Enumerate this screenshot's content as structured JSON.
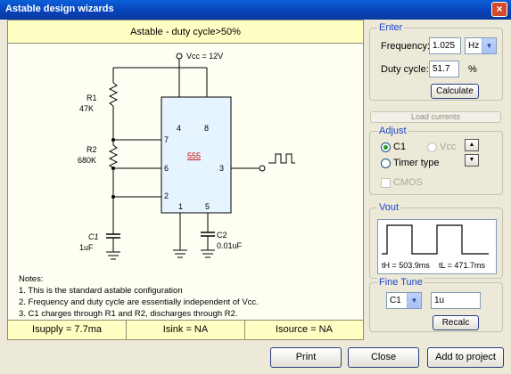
{
  "window": {
    "title": "Astable design wizards",
    "close_glyph": "×"
  },
  "canvas": {
    "header": "Astable - duty cycle>50%",
    "schematic": {
      "vcc": "Vcc = 12V",
      "r1": "R1",
      "r1_val": "47K",
      "r2": "R2",
      "r2_val": "680K",
      "c1": "C1",
      "c1_val": "1uF",
      "c2": "C2",
      "c2_val": "0.01uF",
      "ic": "555",
      "pin4": "4",
      "pin8": "8",
      "pin7": "7",
      "pin6": "6",
      "pin3": "3",
      "pin2": "2",
      "pin1": "1",
      "pin5": "5"
    },
    "notes": {
      "title": "Notes:",
      "lines": [
        "1. This is the standard astable configuration",
        "2. Frequency and duty cycle are essentially independent  of Vcc.",
        "3. C1 charges through R1 and R2, discharges through R2."
      ]
    },
    "footer": {
      "isupply": "Isupply =  7.7ma",
      "isink": "Isink = NA",
      "isource": "Isource = NA"
    }
  },
  "enter": {
    "legend": "Enter",
    "freq_label": "Frequency:",
    "freq_value": "1.025",
    "freq_unit": "Hz",
    "duty_label": "Duty cycle:",
    "duty_value": "51.7",
    "duty_unit": "%",
    "calc": "Calculate"
  },
  "load_currents": "Load currents",
  "adjust": {
    "legend": "Adjust",
    "opt_c1": "C1",
    "opt_vcc": "Vcc",
    "opt_timer": "Timer type",
    "cmos": "CMOS",
    "up": "▲",
    "down": "▼"
  },
  "vout": {
    "legend": "Vout",
    "th": "tH = 503.9ms",
    "tl": "tL = 471.7ms"
  },
  "fine_tune": {
    "legend": "Fine Tune",
    "component": "C1",
    "value": "1u",
    "recalc": "Recalc"
  },
  "buttons": {
    "print": "Print",
    "close": "Close",
    "add": "Add to project"
  },
  "colors": {
    "title_bar": "#0842b8",
    "panel_bg": "#ffffc4",
    "ic_fill": "#e6f4ff",
    "accent": "#1c46c8"
  }
}
